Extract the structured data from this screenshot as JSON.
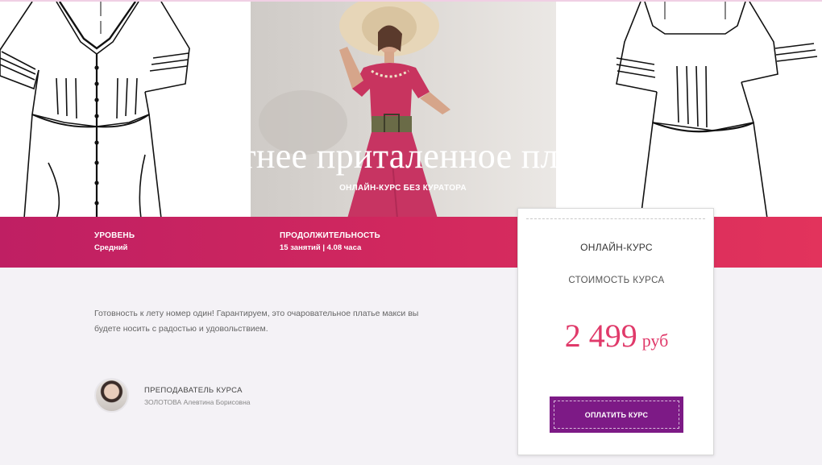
{
  "hero": {
    "title": "Летнее приталенное платье",
    "subtitle": "ОНЛАЙН-КУРС БЕЗ КУРАТОРА"
  },
  "info": {
    "level_label": "УРОВЕНЬ",
    "level_value": "Средний",
    "duration_label": "ПРОДОЛЖИТЕЛЬНОСТЬ",
    "duration_value": "15 занятий | 4.08 часа"
  },
  "description": "Готовность к лету номер один! Гарантируем, это очаровательное платье макси вы будете носить с радостью и удовольствием.",
  "instructor": {
    "label": "ПРЕПОДАВАТЕЛЬ КУРСА",
    "name": "ЗОЛОТОВА Алевтина Борисовна"
  },
  "card": {
    "type": "ОНЛАЙН-КУРС",
    "cost_label": "СТОИМОСТЬ КУРСА",
    "price_amount": "2 499",
    "price_currency": "руб",
    "pay_label": "ОПЛАТИТЬ КУРС"
  },
  "colors": {
    "band_start": "#bf1f63",
    "band_end": "#e2335c",
    "price": "#e03a6a",
    "button": "#7d1a86"
  }
}
